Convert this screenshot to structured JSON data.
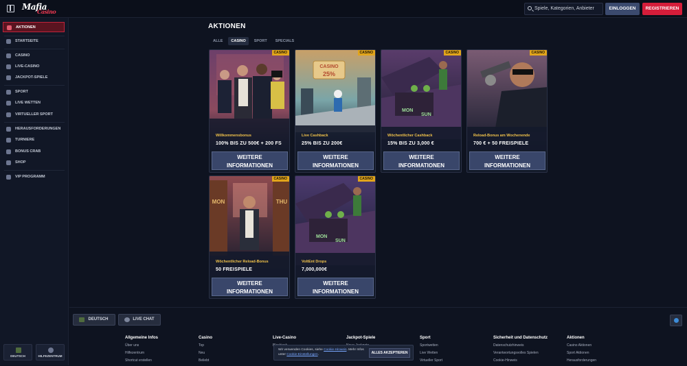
{
  "header": {
    "logo_text": "Mafia",
    "logo_sub": "Casino",
    "search_placeholder": "Spiele, Kategorien, Anbieter",
    "login_label": "EINLOGGEN",
    "register_label": "REGISTRIEREN"
  },
  "sidebar": {
    "items": [
      {
        "label": "Aktionen",
        "active": true
      },
      {
        "label": "Startseite"
      },
      {
        "label": "Casino"
      },
      {
        "label": "Live-Casino"
      },
      {
        "label": "Jackpot-Spiele"
      },
      {
        "label": "Sport"
      },
      {
        "label": "Live Wetten"
      },
      {
        "label": "Virtueller Sport"
      },
      {
        "label": "Herausforderungen"
      },
      {
        "label": "Turniere"
      },
      {
        "label": "Bonus Crab"
      },
      {
        "label": "Shop"
      },
      {
        "label": "VIP Programm"
      }
    ],
    "language_label": "DEUTSCH",
    "help_label": "HILFEZENTRUM"
  },
  "main": {
    "title": "AKTIONEN",
    "tabs": [
      {
        "label": "ALLE"
      },
      {
        "label": "CASINO",
        "active": true
      },
      {
        "label": "SPORT"
      },
      {
        "label": "SPECIALS"
      }
    ],
    "cards": [
      {
        "badge": "CASINO",
        "subtitle": "Willkommensbonus",
        "headline": "100% BIS ZU 500€ + 200 FS",
        "button": "WEITERE\nINFORMATIONEN",
        "art": "crew"
      },
      {
        "badge": "CASINO",
        "subtitle": "Live Cashback",
        "headline": "25% BIS ZU 200€",
        "button": "WEITERE\nINFORMATIONEN",
        "art": "cashback",
        "sign": "CASINO 25%"
      },
      {
        "badge": "CASINO",
        "subtitle": "Wöchentlicher Cashback",
        "headline": "15% BIS ZU 3,000 €",
        "button": "WEITERE\nINFORMATIONEN",
        "art": "trunk",
        "sign": "MON SUN"
      },
      {
        "badge": "CASINO",
        "subtitle": "Reload-Bonus am Wochenende",
        "headline": "700 € + 50 FREISPIELE",
        "button": "WEITERE\nINFORMATIONEN",
        "art": "gun"
      },
      {
        "badge": "CASINO",
        "subtitle": "Wöchentlicher Reload-Bonus",
        "headline": "50 FREISPIELE",
        "button": "WEITERE\nINFORMATIONEN",
        "art": "doors",
        "sign": "MON THU"
      },
      {
        "badge": "CASINO",
        "subtitle": "VoltEnt Drops",
        "headline": "7,000,000€",
        "button": "WEITERE\nINFORMATIONEN",
        "art": "trunk2",
        "sign": "MON SUN"
      }
    ]
  },
  "footer": {
    "language_button": "DEUTSCH",
    "chat_button": "LIVE CHAT",
    "columns": [
      {
        "title": "Allgemeine Infos",
        "links": [
          "Über uns",
          "Hilfezentrum",
          "Shortcut erstellen"
        ]
      },
      {
        "title": "Casino",
        "links": [
          "Top",
          "Neu",
          "Beliebt"
        ]
      },
      {
        "title": "Live-Casino",
        "links": [
          "",
          "",
          "Blackjack"
        ]
      },
      {
        "title": "Jackpot-Spiele",
        "links": [
          "",
          "",
          "Neue Jackpots"
        ]
      },
      {
        "title": "Sport",
        "links": [
          "Sportwetten",
          "Live Wetten",
          "Virtueller Sport"
        ]
      },
      {
        "title": "Sicherheit und Datenschutz",
        "links": [
          "Datenschutzhinweis",
          "Verantwortungsvolles Spielen",
          "Cookie-Hinweis"
        ]
      },
      {
        "title": "Aktionen",
        "links": [
          "Casino Aktionen",
          "Sport Aktionen",
          "Herausforderungen"
        ]
      }
    ],
    "cookie": {
      "text_1": "Wir verwenden Cookies, siehe",
      "link_1": "Cookie-Hinweis",
      "text_2": ". Mehr Infos unter",
      "link_2": "Cookie-Einstellungen",
      "text_3": ".",
      "accept": "ALLES AKZEPTIEREN"
    }
  }
}
